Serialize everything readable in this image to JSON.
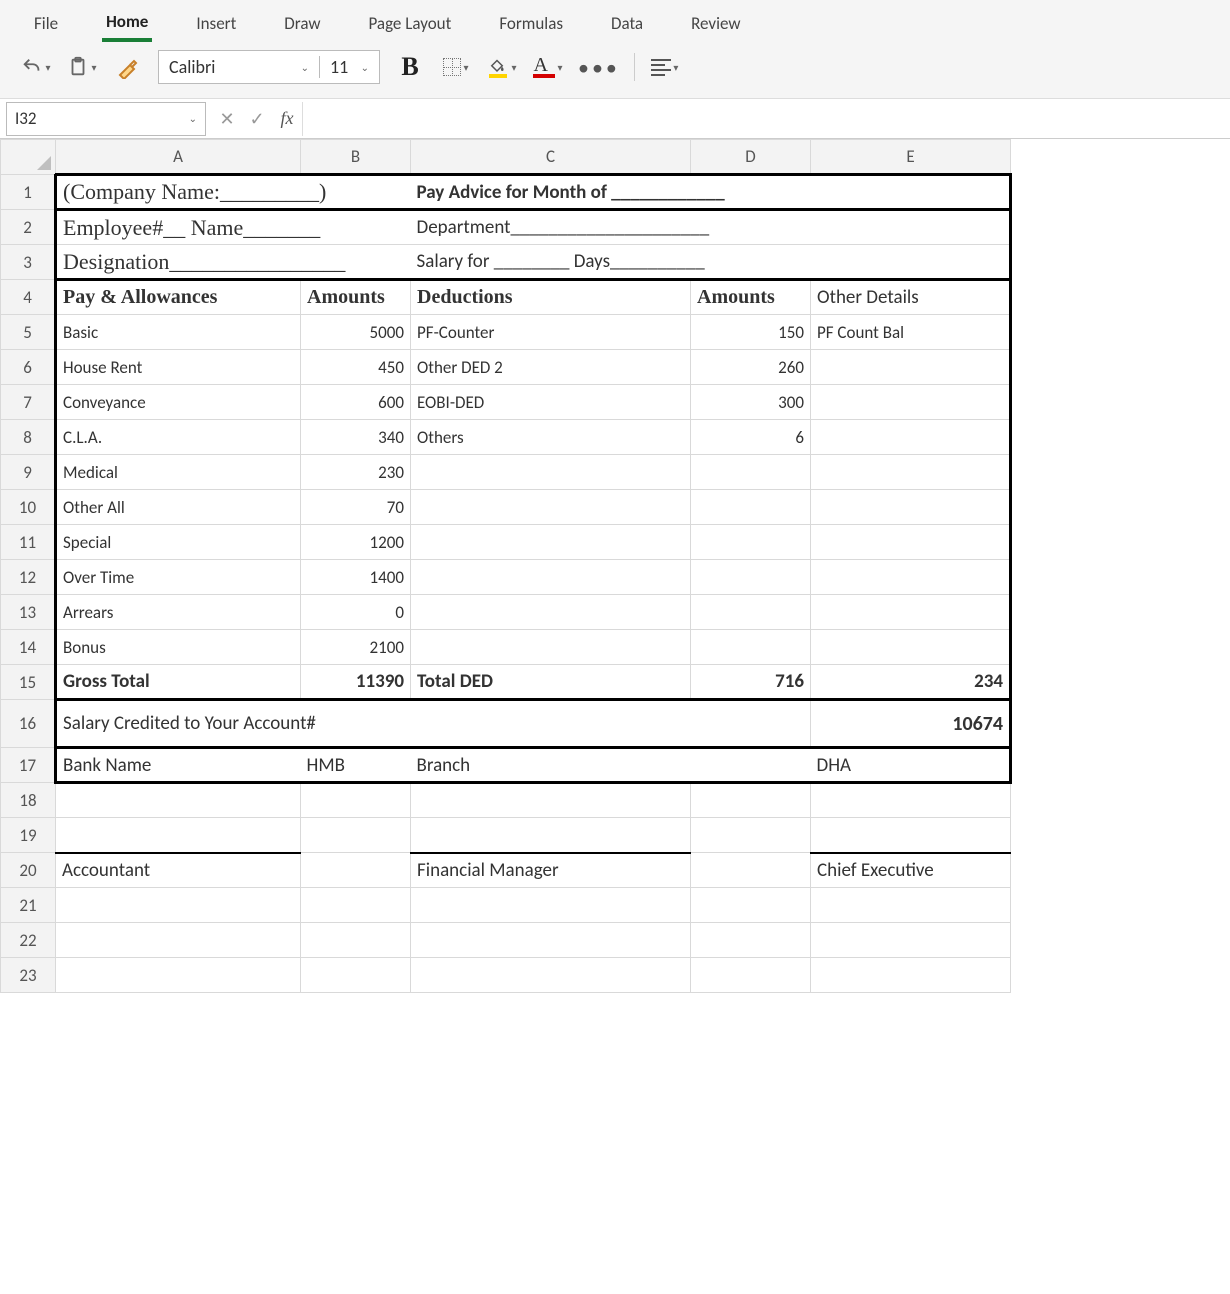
{
  "ribbon": {
    "tabs": [
      "File",
      "Home",
      "Insert",
      "Draw",
      "Page Layout",
      "Formulas",
      "Data",
      "Review"
    ],
    "active_tab": "Home",
    "font_name": "Calibri",
    "font_size": "11"
  },
  "namebox": "I32",
  "columns": [
    "A",
    "B",
    "C",
    "D",
    "E"
  ],
  "row_numbers": [
    "1",
    "2",
    "3",
    "4",
    "5",
    "6",
    "7",
    "8",
    "9",
    "10",
    "11",
    "12",
    "13",
    "14",
    "15",
    "16",
    "17",
    "18",
    "19",
    "20",
    "21",
    "22",
    "23"
  ],
  "doc": {
    "r1": {
      "company_label": "(Company Name:_________)",
      "pay_advice": "Pay Advice for Month of ____________"
    },
    "r2": {
      "emp_name": "Employee#__   Name_______",
      "department": "Department_____________________"
    },
    "r3": {
      "designation": "Designation________________",
      "salary_for": "Salary for ________ Days__________"
    },
    "r4": {
      "pay_allow": "Pay & Allowances",
      "amounts1": "Amounts",
      "deductions": "Deductions",
      "amounts2": "Amounts",
      "other_details": "Other Details"
    },
    "rows": [
      {
        "a": "Basic",
        "b": "5000",
        "c": "PF-Counter",
        "d": "150",
        "e": "PF Count Bal"
      },
      {
        "a": "House Rent",
        "b": "450",
        "c": "Other DED 2",
        "d": "260",
        "e": ""
      },
      {
        "a": "Conveyance",
        "b": "600",
        "c": "EOBI-DED",
        "d": "300",
        "e": ""
      },
      {
        "a": "C.L.A.",
        "b": "340",
        "c": "Others",
        "d": "6",
        "e": ""
      },
      {
        "a": "Medical",
        "b": "230",
        "c": "",
        "d": "",
        "e": ""
      },
      {
        "a": "Other All",
        "b": "70",
        "c": "",
        "d": "",
        "e": ""
      },
      {
        "a": "Special",
        "b": "1200",
        "c": "",
        "d": "",
        "e": ""
      },
      {
        "a": "Over Time",
        "b": "1400",
        "c": "",
        "d": "",
        "e": ""
      },
      {
        "a": "Arrears",
        "b": "0",
        "c": "",
        "d": "",
        "e": ""
      },
      {
        "a": "Bonus",
        "b": "2100",
        "c": "",
        "d": "",
        "e": ""
      }
    ],
    "totals": {
      "gross_label": "Gross Total",
      "gross": "11390",
      "total_ded_label": "Total DED",
      "total_ded": "716",
      "right_val": "234"
    },
    "credited": {
      "label": "Salary Credited to Your Account#",
      "value": "10674"
    },
    "bank": {
      "label": "Bank Name",
      "name": "HMB",
      "branch_label": "Branch",
      "branch": "DHA"
    },
    "sign": {
      "acc": "Accountant",
      "fm": "Financial Manager",
      "ce": "Chief Executive"
    }
  }
}
